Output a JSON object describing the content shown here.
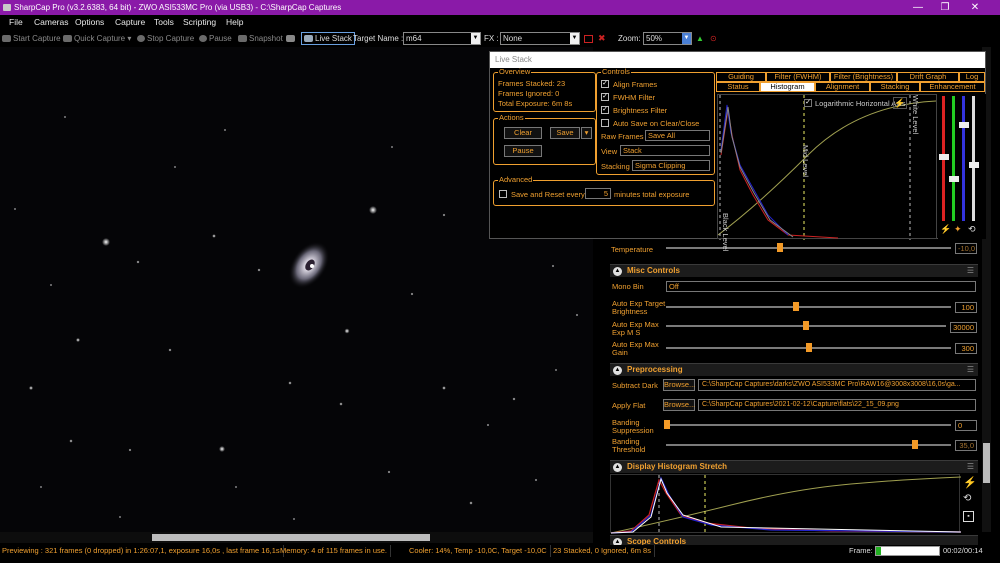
{
  "window": {
    "title": "SharpCap Pro (v3.2.6383, 64 bit) - ZWO ASI533MC Pro (via USB3) - C:\\SharpCap Captures",
    "minimize": "—",
    "maximize": "❐",
    "close": "✕"
  },
  "menu": [
    "File",
    "Cameras",
    "Options",
    "Capture",
    "Tools",
    "Scripting",
    "Help"
  ],
  "toolbar": {
    "start_capture": "Start Capture",
    "quick_capture": "Quick Capture",
    "stop_capture": "Stop Capture",
    "pause": "Pause",
    "snapshot": "Snapshot",
    "live_stack": "Live Stack",
    "target_label": "Target Name :",
    "target_value": "m64",
    "fx_label": "FX :",
    "fx_value": "None",
    "zoom_label": "Zoom:",
    "zoom_value": "50%"
  },
  "livestack": {
    "title": "Live Stack",
    "overview": {
      "title": "Overview",
      "frames_stacked": "Frames Stacked: 23",
      "frames_ignored": "Frames Ignored:  0",
      "total_exposure": "Total Exposure:   6m 8s"
    },
    "controls": {
      "title": "Controls",
      "align": "Align Frames",
      "fwhm": "FWHM Filter",
      "brightness": "Brightness Filter",
      "autosave": "Auto Save on Clear/Close",
      "raw_frames_label": "Raw Frames",
      "raw_frames_value": "Save All",
      "view_label": "View",
      "view_value": "Stack",
      "stacking_label": "Stacking",
      "stacking_value": "Sigma Clipping"
    },
    "actions": {
      "title": "Actions",
      "clear": "Clear",
      "save": "Save",
      "pause": "Pause"
    },
    "advanced": {
      "title": "Advanced",
      "save_reset": "Save and Reset every",
      "minutes": "5",
      "suffix": "minutes total exposure"
    },
    "tabs_row1": [
      "Guiding",
      "Filter (FWHM)",
      "Filter (Brightness)",
      "Drift Graph",
      "Log"
    ],
    "tabs_row2": [
      "Status",
      "Histogram",
      "Alignment",
      "Stacking",
      "Enhancement"
    ],
    "histogram": {
      "log_axis": "Logarithmic Horizontal Axis",
      "black_level": "Black Level",
      "mid_level": "Mid Level",
      "white_level": "White Level"
    }
  },
  "panel": {
    "temperature_label": "Temperature",
    "temperature_value": "-10,0",
    "misc_title": "Misc Controls",
    "mono_bin_label": "Mono Bin",
    "mono_bin_value": "Off",
    "auto_target_label": "Auto Exp Target Brightness",
    "auto_target_value": "100",
    "auto_max_ms_label": "Auto Exp Max Exp M S",
    "auto_max_ms_value": "30000",
    "auto_max_gain_label": "Auto Exp Max Gain",
    "auto_max_gain_value": "300",
    "pre_title": "Preprocessing",
    "dark_label": "Subtract Dark",
    "dark_browse": "Browse...",
    "dark_path": "C:\\SharpCap Captures\\darks\\ZWO ASI533MC Pro\\RAW16@3008x3008\\16,0s\\ga...",
    "flat_label": "Apply Flat",
    "flat_browse": "Browse...",
    "flat_path": "C:\\SharpCap Captures\\2021-02-12\\Capture\\flats\\22_15_09.png",
    "banding_supp_label": "Banding Suppression",
    "banding_supp_value": "0",
    "banding_thr_label": "Banding Threshold",
    "banding_thr_value": "35,0",
    "stretch_title": "Display Histogram Stretch",
    "scope_title": "Scope Controls"
  },
  "status": {
    "preview": "Previewing : 321 frames (0 dropped) in 1:26:07,1, exposure 16,0s , last frame 16,1s",
    "memory": "Memory: 4 of 115 frames in use.",
    "cooler": "Cooler: 14%, Temp -10,0C, Target -10,0C",
    "stack": "23 Stacked, 0 Ignored, 6m 8s",
    "frame_label": "Frame:",
    "time": "00:02/00:14",
    "frame_progress": 0.08
  },
  "colors": {
    "accent": "#f0a030",
    "title_bar": "#8a1aa8"
  }
}
